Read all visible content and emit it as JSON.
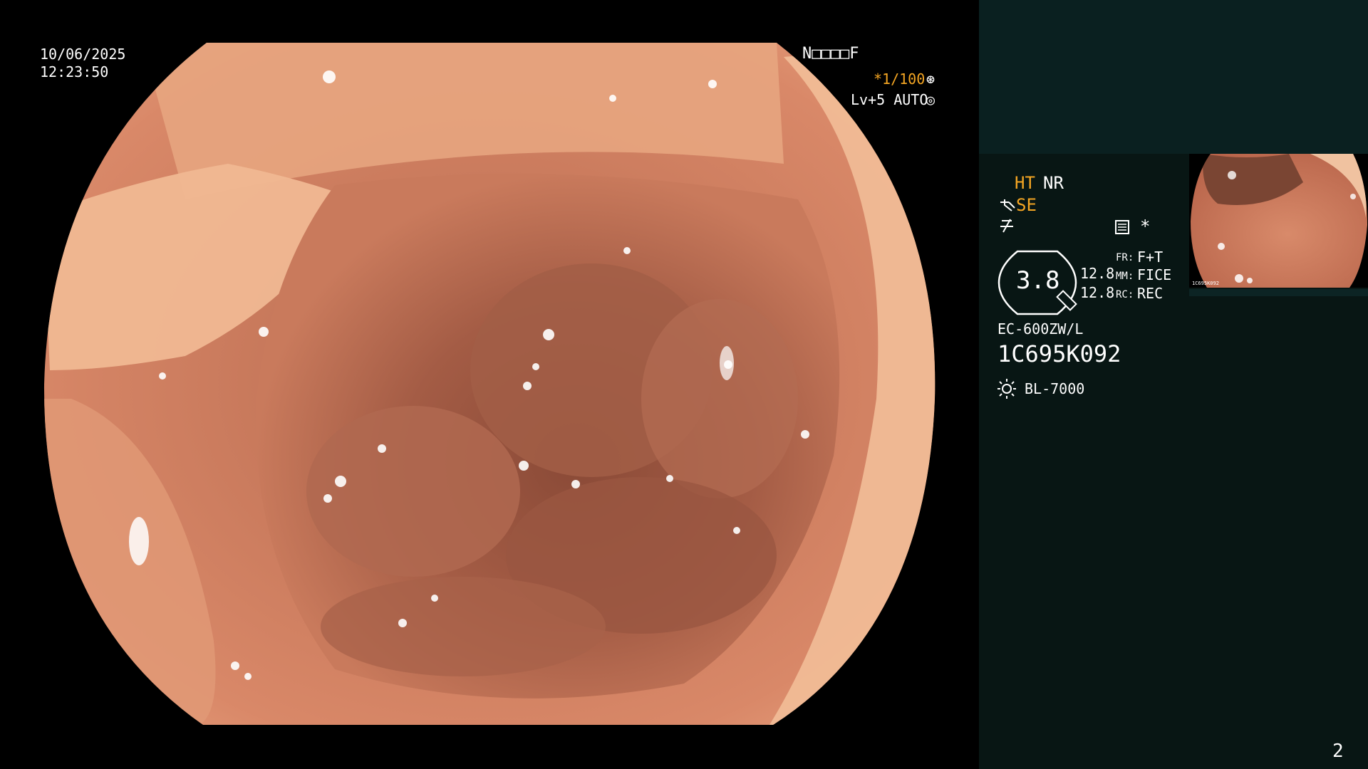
{
  "image": {
    "description_icon": "endoscopy-view",
    "colors": {
      "mucosa": "#c7785a",
      "highlight": "#f1c7a8",
      "shadow": "#6e3a2b",
      "panel": "#081614",
      "panel_top": "#0a2020",
      "amber": "#f5a623"
    }
  },
  "osd": {
    "date": "10/06/2025",
    "time": "12:23:50",
    "patient_code": "N□□□□F",
    "shutter": "*1/100",
    "shutter_icon": "shutter-icon",
    "level": "Lv+5 AUTO",
    "auto_icon": "auto-iris-icon"
  },
  "panel": {
    "ht": "HT",
    "nr": "NR",
    "se": "SE",
    "se_icon": "scope-icon",
    "f_icon": "filter-icon",
    "menu_icon": "menu-icon",
    "star": "*",
    "zoom_value": "3.8",
    "zoom_icon": "zoom-dial-icon",
    "val1": "12.8",
    "val2": "12.8",
    "fr_label": "FR:",
    "fr_value": "F+T",
    "mm_label": "MM:",
    "mm_value": "FICE",
    "rc_label": "RC:",
    "rc_value": "REC",
    "scope_model": "EC-600ZW/L",
    "serial": "1C695K092",
    "light_icon": "light-source-icon",
    "light_model": "BL-7000",
    "page_number": "2"
  },
  "thumbnail": {
    "icon": "thumbnail-image",
    "tiny_label": "1C695K092"
  }
}
